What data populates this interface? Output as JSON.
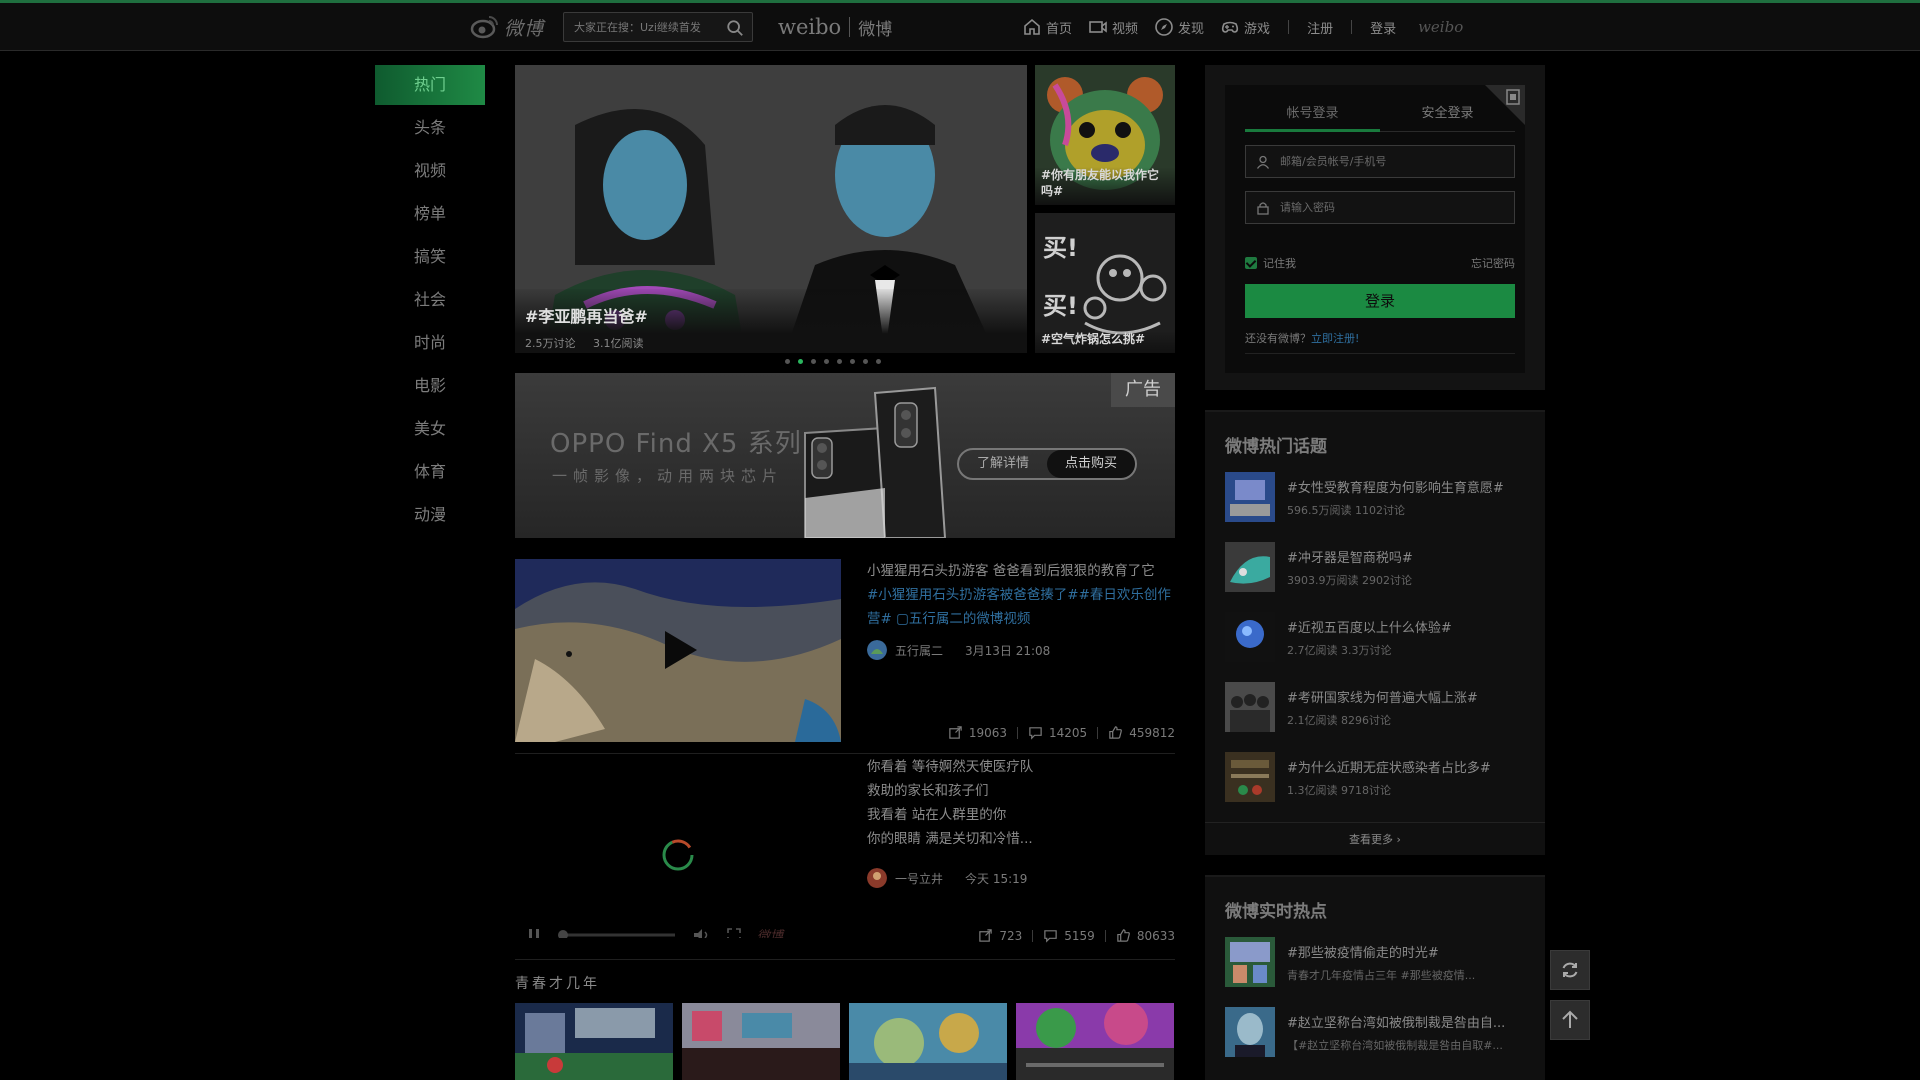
{
  "header": {
    "logo_text": "微博",
    "search_placeholder": "大家正在搜：Uzi继续首发",
    "brand_en": "weibo",
    "brand_cn": "微博",
    "nav": [
      {
        "label": "首页",
        "icon": "home-icon"
      },
      {
        "label": "视频",
        "icon": "video-icon"
      },
      {
        "label": "发现",
        "icon": "compass-icon"
      },
      {
        "label": "游戏",
        "icon": "gamepad-icon"
      }
    ],
    "register": "注册",
    "login": "登录",
    "weibo_mark": "weibo"
  },
  "leftnav": [
    "热门",
    "头条",
    "视频",
    "榜单",
    "搞笑",
    "社会",
    "时尚",
    "电影",
    "美女",
    "体育",
    "动漫"
  ],
  "hero": {
    "title": "#李亚鹏再当爸#",
    "discussions": "2.5万讨论",
    "reads": "3.1亿阅读",
    "side1_caption": "#你有朋友能以我作它吗#",
    "side2_caption": "#空气炸锅怎么挑#",
    "side2_text": "买! 买!"
  },
  "ad": {
    "tag": "广告",
    "title": "OPPO Find X5 系列",
    "subtitle": "一帧影像，动用两块芯片",
    "btn_more": "了解详情",
    "btn_buy": "点击购买"
  },
  "feed": [
    {
      "text": "小猩猩用石头扔游客 爸爸看到后狠狠的教育了它",
      "tags": "#小猩猩用石头扔游客被爸爸揍了##春日欢乐创作营# ▢五行属二的微博视频",
      "author": "五行属二",
      "time": "3月13日 21:08",
      "shares": "19063",
      "comments": "14205",
      "likes": "459812"
    },
    {
      "lines": [
        "你看着 等待婀然天使医疗队",
        "救助的家长和孩子们",
        "我看着 站在人群里的你",
        "你的眼睛 满是关切和冷惜..."
      ],
      "author": "一号立井",
      "time": "今天 15:19",
      "shares": "723",
      "comments": "5159",
      "likes": "80633",
      "player_watermark": "微博"
    }
  ],
  "section_title": "青春才几年",
  "login": {
    "tab_account": "帐号登录",
    "tab_secure": "安全登录",
    "user_placeholder": "邮箱/会员帐号/手机号",
    "pass_placeholder": "请输入密码",
    "remember": "记住我",
    "forgot": "忘记密码",
    "button": "登录",
    "no_account": "还没有微博？",
    "register_link": "立即注册!"
  },
  "hot_topics": {
    "title": "微博热门话题",
    "items": [
      {
        "title": "#女性受教育程度为何影响生育意愿#",
        "meta": "596.5万阅读 1102讨论"
      },
      {
        "title": "#冲牙器是智商税吗#",
        "meta": "3903.9万阅读 2902讨论"
      },
      {
        "title": "#近视五百度以上什么体验#",
        "meta": "2.7亿阅读 3.3万讨论"
      },
      {
        "title": "#考研国家线为何普遍大幅上涨#",
        "meta": "2.1亿阅读 8296讨论"
      },
      {
        "title": "#为什么近期无症状感染者占比多#",
        "meta": "1.3亿阅读 9718讨论"
      }
    ],
    "more": "查看更多 ›"
  },
  "realtime": {
    "title": "微博实时热点",
    "items": [
      {
        "title": "#那些被疫情偷走的时光#",
        "meta": "青春才几年疫情占三年 #那些被疫情..."
      },
      {
        "title": "#赵立坚称台湾如被俄制裁是咎由自...",
        "meta": "【#赵立坚称台湾如被俄制裁是咎由自取#..."
      }
    ]
  },
  "colors": {
    "accent": "#1b8a42",
    "link": "#2f6f9f",
    "bg": "#000000"
  }
}
